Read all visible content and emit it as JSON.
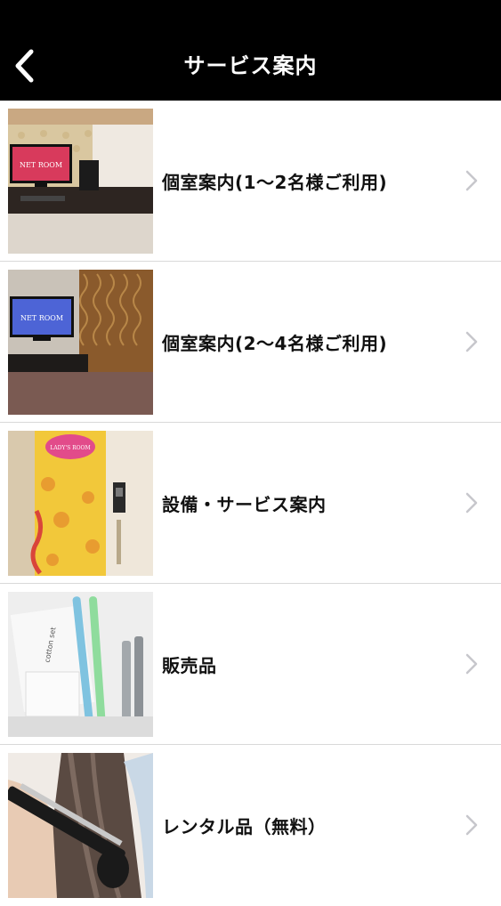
{
  "header": {
    "title": "サービス案内",
    "back_icon": "chevron-left-icon"
  },
  "rows": [
    {
      "label": "個室案内(1〜2名様ご利用)",
      "thumb_text": "NET ROOM"
    },
    {
      "label": "個室案内(2〜4名様ご利用)",
      "thumb_text": "NET ROOM"
    },
    {
      "label": "設備・サービス案内",
      "thumb_text": "LADY'S ROOM"
    },
    {
      "label": "販売品",
      "thumb_text": "cotton set"
    },
    {
      "label": "レンタル品（無料）"
    }
  ],
  "colors": {
    "header_bg": "#000000",
    "header_text": "#ffffff",
    "divider": "#d9d9d9",
    "chevron": "#c7c7cc"
  }
}
